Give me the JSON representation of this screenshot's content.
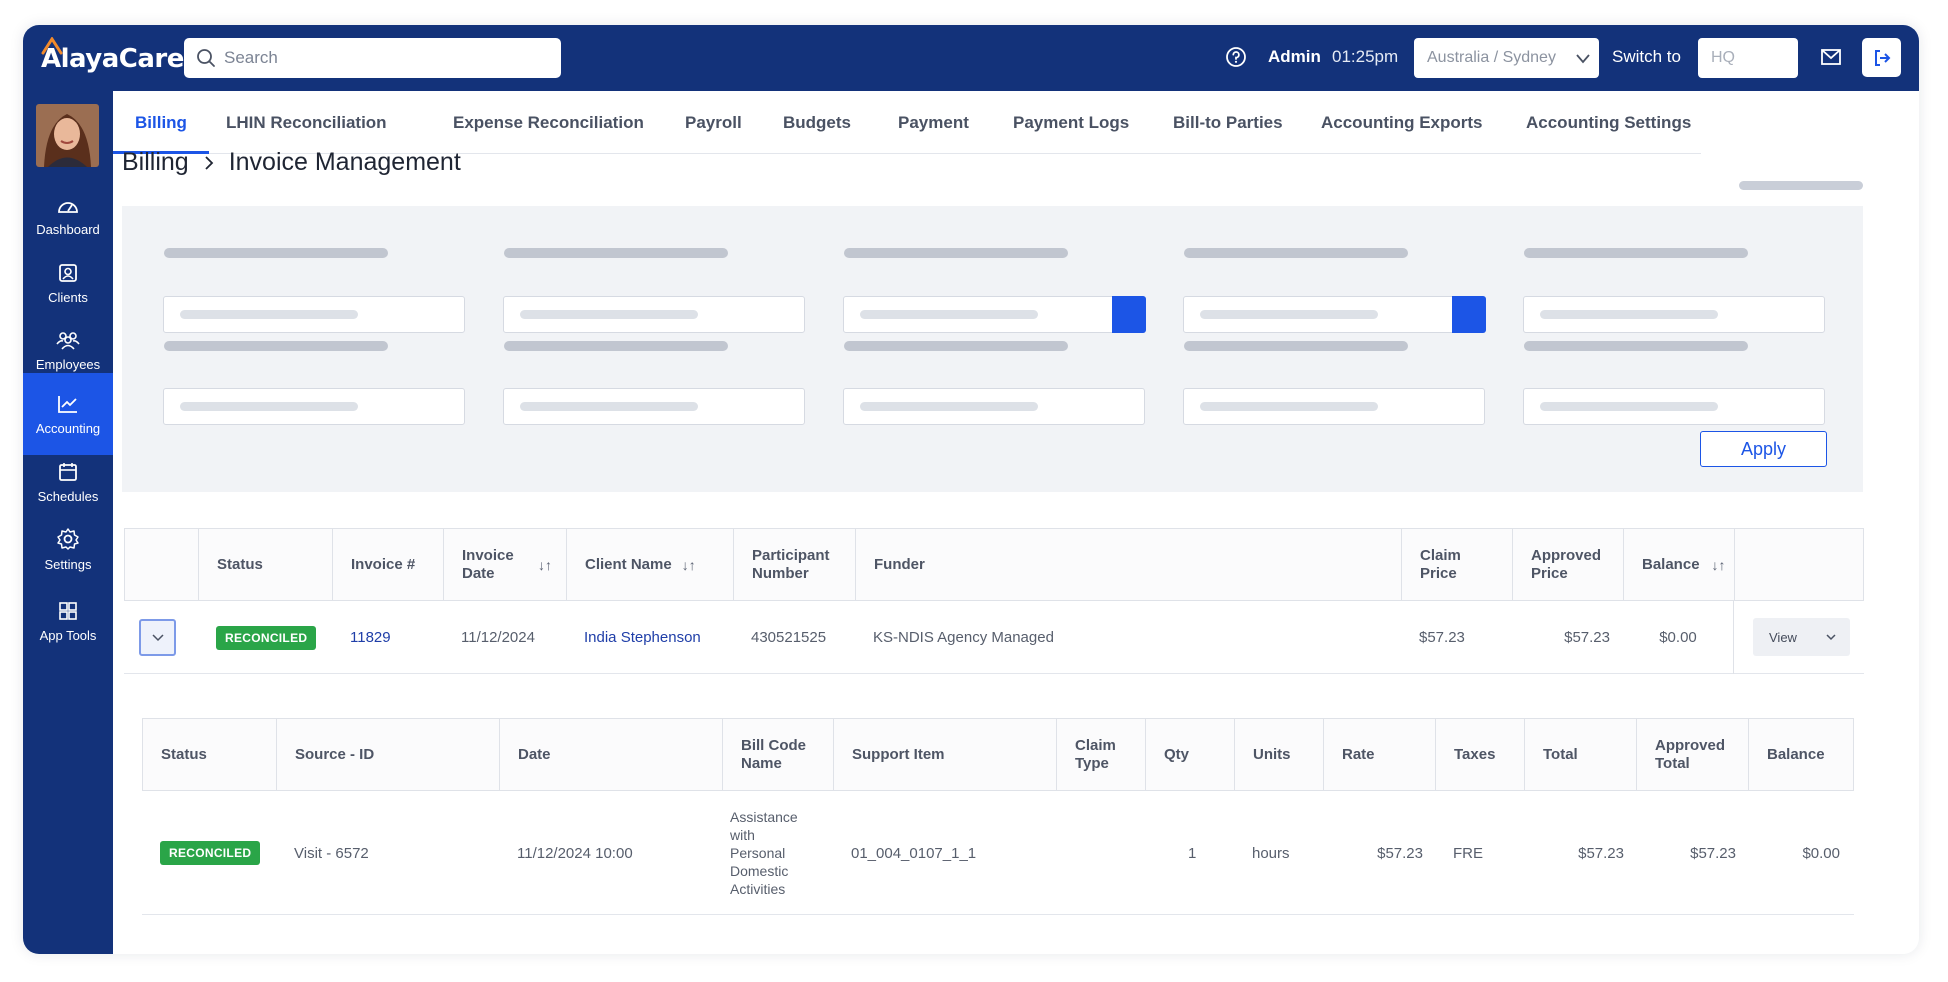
{
  "app": {
    "logo_text": "AlayaCare"
  },
  "header": {
    "search_placeholder": "Search",
    "user_label": "Admin",
    "time": "01:25pm",
    "timezone": "Australia / Sydney",
    "switch_label": "Switch to",
    "switch_placeholder": "HQ"
  },
  "sidebar": {
    "items": [
      {
        "label": "Dashboard",
        "icon": "dashboard-icon"
      },
      {
        "label": "Clients",
        "icon": "clients-icon"
      },
      {
        "label": "Employees",
        "icon": "employees-icon"
      },
      {
        "label": "Accounting",
        "icon": "accounting-icon",
        "active": true
      },
      {
        "label": "Schedules",
        "icon": "calendar-icon"
      },
      {
        "label": "Settings",
        "icon": "gear-icon"
      },
      {
        "label": "App Tools",
        "icon": "grid-icon"
      }
    ]
  },
  "tabs": [
    {
      "label": "Billing",
      "active": true
    },
    {
      "label": "LHIN Reconciliation"
    },
    {
      "label": "Expense Reconciliation"
    },
    {
      "label": "Payroll"
    },
    {
      "label": "Budgets"
    },
    {
      "label": "Payment"
    },
    {
      "label": "Payment Logs"
    },
    {
      "label": "Bill-to Parties"
    },
    {
      "label": "Accounting Exports"
    },
    {
      "label": "Accounting Settings"
    }
  ],
  "breadcrumb": {
    "parent": "Billing",
    "separator": "›",
    "current": "Invoice Management"
  },
  "filters": {
    "apply_label": "Apply"
  },
  "invoice_table": {
    "headers": {
      "status": "Status",
      "invoice_no": "Invoice #",
      "invoice_date": "Invoice Date",
      "client_name": "Client Name",
      "participant_number": "Participant Number",
      "funder": "Funder",
      "claim_price": "Claim Price",
      "approved_price": "Approved Price",
      "balance": "Balance"
    },
    "sort_glyph": "↓↑",
    "row": {
      "status": "RECONCILED",
      "invoice_no": "11829",
      "invoice_date": "11/12/2024",
      "client_name": "India Stephenson",
      "participant_number": "430521525",
      "funder": "KS-NDIS Agency Managed",
      "claim_price": "$57.23",
      "approved_price": "$57.23",
      "balance": "$0.00",
      "action": "View"
    }
  },
  "line_table": {
    "headers": {
      "status": "Status",
      "source_id": "Source - ID",
      "date": "Date",
      "bill_code_name": "Bill Code Name",
      "support_item": "Support Item",
      "claim_type": "Claim Type",
      "qty": "Qty",
      "units": "Units",
      "rate": "Rate",
      "taxes": "Taxes",
      "total": "Total",
      "approved_total": "Approved Total",
      "balance": "Balance"
    },
    "row": {
      "status": "RECONCILED",
      "source_id": "Visit - 6572",
      "date": "11/12/2024 10:00",
      "bill_code_name": "Assistance with Personal Domestic Activities",
      "support_item": "01_004_0107_1_1",
      "claim_type": "",
      "qty": "1",
      "units": "hours",
      "rate": "$57.23",
      "taxes": "FRE",
      "total": "$57.23",
      "approved_total": "$57.23",
      "balance": "$0.00"
    }
  },
  "colors": {
    "nav_bg": "#13327a",
    "accent": "#1c55e6",
    "reconciled": "#2aa548",
    "link": "#1f3ea8"
  }
}
